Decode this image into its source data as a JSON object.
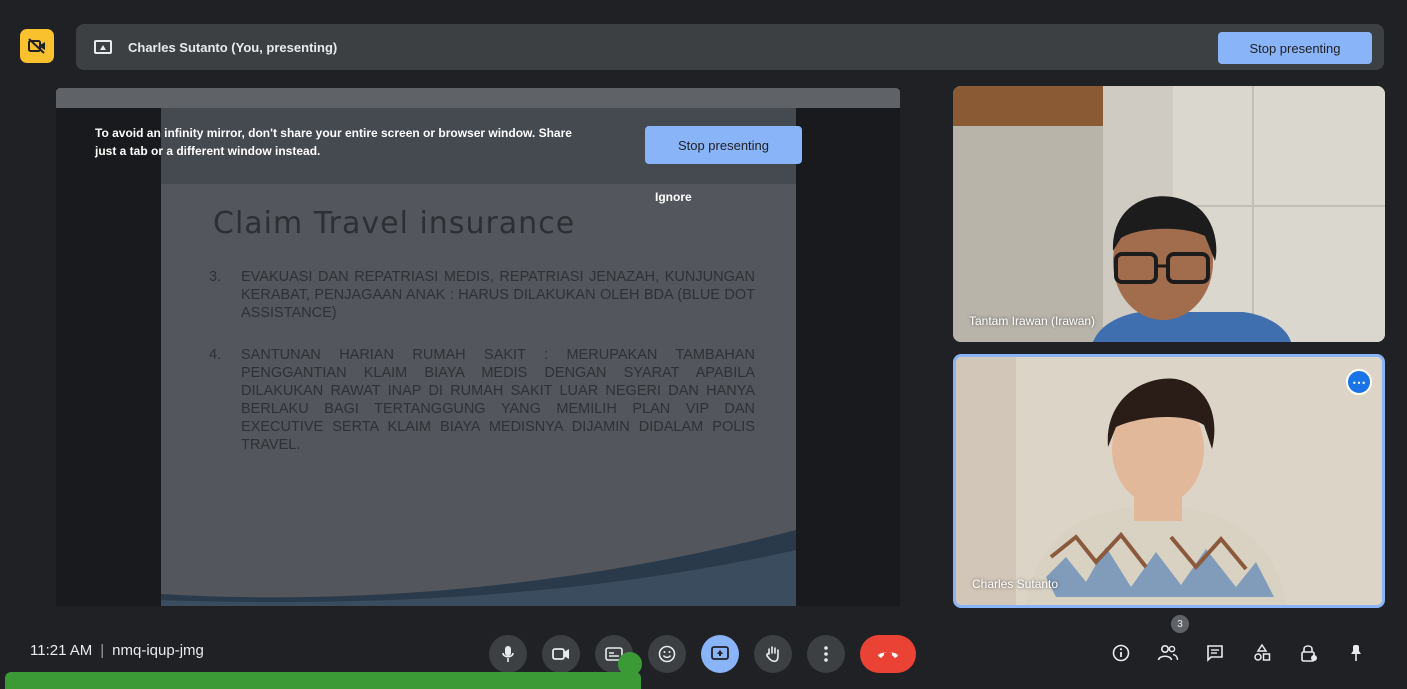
{
  "top_banner": {
    "title": "Charles Sutanto (You, presenting)",
    "stop_button": "Stop presenting",
    "camera_badge_icon": "camera-off-icon"
  },
  "warning": {
    "text": "To avoid an infinity mirror, don't share your entire screen or browser window. Share just a tab or a different window instead.",
    "stop_button": "Stop presenting",
    "ignore_button": "Ignore"
  },
  "slide": {
    "title": "Claim Travel insurance",
    "items": [
      {
        "num": "3.",
        "text": "Evakuasi dan repatriasi medis, repatriasi jenazah, kunjungan kerabat, penjagaan anak : harus dilakukan oleh BDA (Blue Dot Assistance)"
      },
      {
        "num": "4.",
        "text": "Santunan harian rumah sakit : merupakan tambahan penggantian klaim biaya medis dengan syarat apabila dilakukan rawat inap di rumah sakit  luar negeri dan hanya berlaku bagi tertanggung yang memilih plan VIP dan executive serta klaim biaya medisnya  dijamin didalam polis travel."
      }
    ]
  },
  "participants": [
    {
      "name": "Tantam Irawan (Irawan)"
    },
    {
      "name": "Charles Sutanto",
      "more_icon": "more-options-icon"
    }
  ],
  "bottom_bar": {
    "time": "11:21 AM",
    "separator": "|",
    "meeting_code": "nmq-iqup-jmg",
    "people_count": "3",
    "controls": [
      "microphone-icon",
      "camera-icon",
      "captions-icon",
      "emoji-icon",
      "present-icon",
      "raise-hand-icon",
      "more-options-icon",
      "end-call-icon"
    ],
    "right_controls": [
      "info-icon",
      "people-icon",
      "chat-icon",
      "activities-icon",
      "host-controls-icon",
      "pin-icon"
    ]
  },
  "colors": {
    "accent": "#8ab4f8",
    "end_call": "#ea4335",
    "badge": "#f9c12e",
    "overlay_green": "#3c9a36"
  }
}
